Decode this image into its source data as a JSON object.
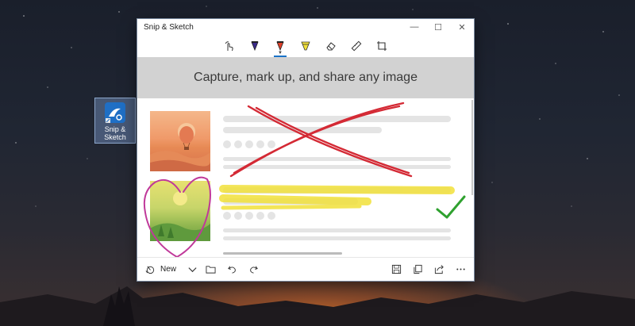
{
  "desktop": {
    "icon_label_line1": "Snip &",
    "icon_label_line2": "Sketch"
  },
  "window": {
    "title": "Snip & Sketch",
    "controls": [
      "minimize",
      "maximize",
      "close"
    ]
  },
  "toolbar": {
    "tools": [
      {
        "name": "touch-writing-icon"
      },
      {
        "name": "ballpoint-pen-icon",
        "color": "#3a2a8a"
      },
      {
        "name": "pencil-icon",
        "color": "#e0402a",
        "active": true
      },
      {
        "name": "highlighter-icon",
        "color": "#f2e13a"
      },
      {
        "name": "eraser-icon"
      },
      {
        "name": "ruler-icon"
      },
      {
        "name": "crop-icon"
      }
    ]
  },
  "content": {
    "hero_text": "Capture, mark up, and share any image"
  },
  "bottom_bar": {
    "new_label": "New"
  },
  "colors": {
    "accent": "#1a73c8",
    "annotation_red": "#d42a35",
    "annotation_yellow": "#f2e13a",
    "annotation_magenta": "#c0399a",
    "annotation_green": "#2fa12f"
  }
}
